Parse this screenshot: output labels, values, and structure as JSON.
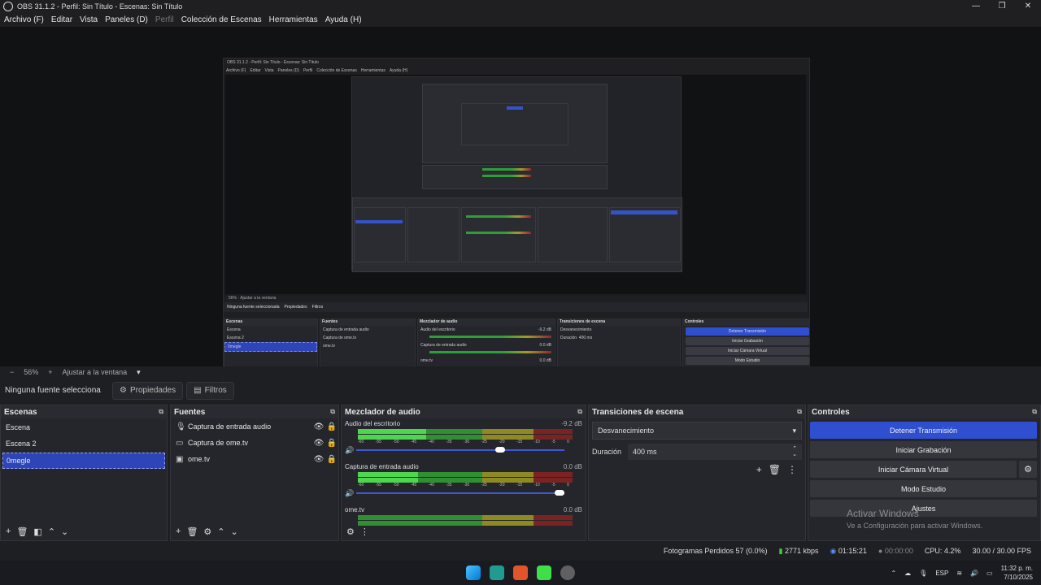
{
  "window": {
    "title": "OBS 31.1.2 - Perfil: Sin Título - Escenas: Sin Título",
    "minimize": "—",
    "maximize": "❐",
    "close": "✕"
  },
  "menu": [
    "Archivo (F)",
    "Editar",
    "Vista",
    "Paneles (D)",
    "Perfil",
    "Colección de Escenas",
    "Herramientas",
    "Ayuda (H)"
  ],
  "preview_nested": {
    "title": "OBS 31.1.2 - Perfil: Sin Título - Escenas: Sin Título",
    "menu": [
      "Archivo (F)",
      "Editar",
      "Vista",
      "Paneles (D)",
      "Perfil",
      "Colección de Escenas",
      "Herramientas",
      "Ayuda (H)"
    ],
    "zoom": "56%",
    "fit": "Ajustar a la ventana",
    "no_source": "Ninguna fuente seleccionada",
    "properties": "Propiedades",
    "filters": "Filtros",
    "docks": {
      "scenes": "Escenas",
      "sources": "Fuentes",
      "mixer": "Mezclador de audio",
      "transitions": "Transiciones de escena",
      "controls": "Controles"
    },
    "scenes": [
      "Escena",
      "Escena 2",
      "0megle"
    ],
    "sources": [
      "Captura de entrada audio",
      "Captura de ome.tv",
      "ome.tv"
    ],
    "mixer": [
      {
        "name": "Audio del escritorio",
        "db": "-9.2 dB"
      },
      {
        "name": "Captura de entrada audio",
        "db": "0.0 dB"
      },
      {
        "name": "ome.tv",
        "db": "0.0 dB"
      }
    ],
    "transition": "Desvanecimiento",
    "duration_label": "Duración",
    "duration": "400 ms",
    "controls": [
      "Detener Transmisión",
      "Iniciar Grabación",
      "Iniciar Cámara Virtual",
      "Modo Estudio",
      "Ajustes"
    ],
    "watermark1": "Activar Windows",
    "watermark2": "Ve a Configuración para activar Windows.",
    "status": "Fotogramas Perdidos 57 (0.0%)   2771 kbps   01:15:21   00:00:00   CPU: 4.2%   30.00 / 30.00 FPS",
    "tray_lang": "ESP",
    "tray_time": "11:32 p. m.",
    "tray_date": "7/10/2025"
  },
  "zoombar": {
    "minus": "−",
    "zoom": "56%",
    "plus": "+",
    "fit": "Ajustar a la ventana",
    "arrow": "▾"
  },
  "sourcebar": {
    "no_source": "Ninguna fuente selecciona",
    "properties": "Propiedades",
    "properties_icon": "⚙",
    "filters": "Filtros",
    "filters_icon": "▤"
  },
  "scenes": {
    "title": "Escenas",
    "items": [
      "Escena",
      "Escena 2",
      "0megle"
    ],
    "selected_index": 2
  },
  "sources": {
    "title": "Fuentes",
    "items": [
      {
        "icon": "microphone-icon",
        "glyph": "🎙",
        "name": "Captura de entrada audio"
      },
      {
        "icon": "monitor-icon",
        "glyph": "▭",
        "name": "Captura de ome.tv"
      },
      {
        "icon": "browser-icon",
        "glyph": "▣",
        "name": "ome.tv"
      }
    ]
  },
  "mixer": {
    "title": "Mezclador de audio",
    "channels": [
      {
        "name": "Audio del escritorio",
        "db": "-9.2 dB",
        "level": 0.55,
        "volume": 0.7
      },
      {
        "name": "Captura de entrada audio",
        "db": "0.0 dB",
        "level": 0.48,
        "volume": 1.0
      },
      {
        "name": "ome.tv",
        "db": "0.0 dB",
        "level": 0.0,
        "volume": 1.0
      }
    ],
    "scale": [
      "-60",
      "-55",
      "-50",
      "-45",
      "-40",
      "-35",
      "-30",
      "-25",
      "-20",
      "-15",
      "-10",
      "-5",
      "0"
    ]
  },
  "transitions": {
    "title": "Transiciones de escena",
    "selected": "Desvanecimiento",
    "duration_label": "Duración",
    "duration": "400 ms"
  },
  "controls": {
    "title": "Controles",
    "stop_stream": "Detener Transmisión",
    "start_recording": "Iniciar Grabación",
    "start_virtual_cam": "Iniciar Cámara Virtual",
    "studio_mode": "Modo Estudio",
    "settings": "Ajustes"
  },
  "watermark": {
    "line1": "Activar Windows",
    "line2": "Ve a Configuración para activar Windows."
  },
  "statusbar": {
    "dropped": "Fotogramas Perdidos 57 (0.0%)",
    "bitrate": "2771 kbps",
    "stream_time": "01:15:21",
    "rec_time": "00:00:00",
    "cpu": "CPU: 4.2%",
    "fps": "30.00 / 30.00 FPS"
  },
  "taskbar": {
    "lang": "ESP",
    "time": "11:32 p. m.",
    "date": "7/10/2025",
    "icons": [
      "windows-start-icon",
      "edge-icon",
      "brave-icon",
      "razer-icon",
      "obs-icon"
    ],
    "colors": [
      "#3aa0ff",
      "#1f9c8f",
      "#e2542a",
      "#3ee04a",
      "#606060"
    ]
  },
  "colors": {
    "accent": "#2f4fd0",
    "selection": "#2d45b8",
    "meter_green": "#2f8f32",
    "meter_yellow": "#8e8a23",
    "meter_red": "#7a2323"
  }
}
